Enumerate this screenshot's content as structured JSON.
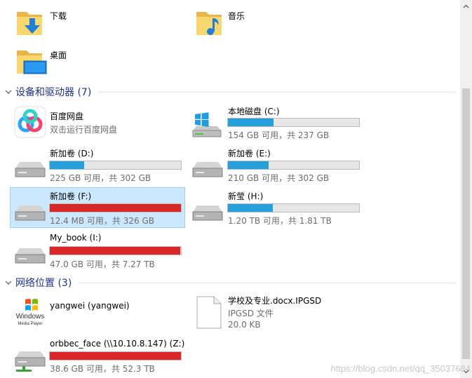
{
  "folders": [
    {
      "name": "下载",
      "icon": "downloads-folder-icon"
    },
    {
      "name": "音乐",
      "icon": "music-folder-icon"
    },
    {
      "name": "桌面",
      "icon": "desktop-folder-icon"
    }
  ],
  "devices_group": {
    "title": "设备和驱动器 (7)"
  },
  "devices": [
    {
      "name": "百度网盘",
      "sub": "双击运行百度网盘",
      "icon": "baidu-netdisk-icon"
    },
    {
      "name": "本地磁盘 (C:)",
      "sub": "154 GB 可用，共 237 GB",
      "usage": 0.35,
      "bar_color": "#26a0da",
      "icon": "windows-drive-icon"
    },
    {
      "name": "新加卷 (D:)",
      "sub": "225 GB 可用，共 302 GB",
      "usage": 0.26,
      "bar_color": "#26a0da",
      "icon": "hard-drive-icon"
    },
    {
      "name": "新加卷 (E:)",
      "sub": "210 GB 可用，共 302 GB",
      "usage": 0.31,
      "bar_color": "#26a0da",
      "icon": "hard-drive-icon"
    },
    {
      "name": "新加卷 (F:)",
      "sub": "12.4 MB 可用，共 326 GB",
      "usage": 0.999,
      "bar_color": "#da2626",
      "icon": "hard-drive-icon",
      "selected": true
    },
    {
      "name": "新莹 (H:)",
      "sub": "1.20 TB 可用，共 1.81 TB",
      "usage": 0.34,
      "bar_color": "#26a0da",
      "icon": "hard-drive-icon"
    },
    {
      "name": "My_book (I:)",
      "sub": "47.0 GB 可用，共 7.27 TB",
      "usage": 0.994,
      "bar_color": "#da2626",
      "icon": "hard-drive-icon"
    }
  ],
  "network_group": {
    "title": "网络位置 (3)"
  },
  "network": [
    {
      "name": "yangwei (yangwei)",
      "icon": "windows-media-player-icon",
      "logo_text_1": "Windows",
      "logo_text_2": "Media Player"
    },
    {
      "name": "学校及专业.docx.IPGSD",
      "sub": "IPGSD 文件",
      "sub2": "20.0 KB",
      "icon": "file-icon"
    },
    {
      "name": "orbbec_face (\\\\10.10.8.147) (Z:)",
      "sub": "38.6 GB 可用，共 52.3 TB",
      "usage": 0.999,
      "bar_color": "#da2626",
      "icon": "network-drive-icon"
    }
  ],
  "watermark": "https://blog.csdn.net/qq_35037684"
}
